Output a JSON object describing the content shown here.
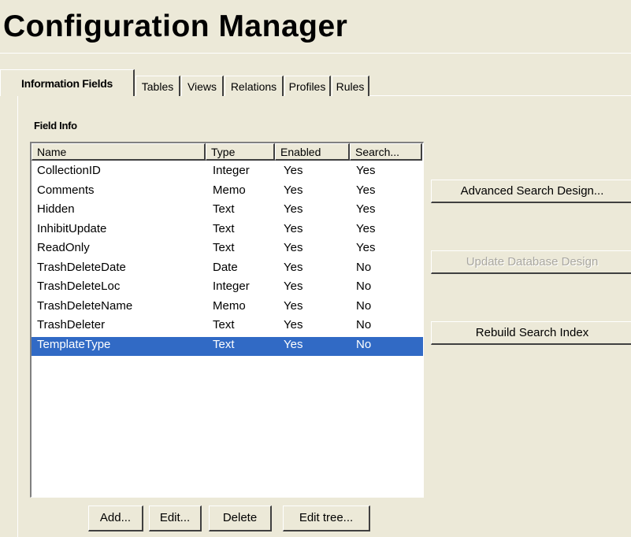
{
  "window": {
    "title": "Configuration Manager"
  },
  "tabs": [
    {
      "label": "Information Fields",
      "active": true
    },
    {
      "label": "Tables",
      "active": false
    },
    {
      "label": "Views",
      "active": false
    },
    {
      "label": "Relations",
      "active": false
    },
    {
      "label": "Profiles",
      "active": false
    },
    {
      "label": "Rules",
      "active": false
    }
  ],
  "field_info": {
    "label": "Field Info",
    "columns": [
      "Name",
      "Type",
      "Enabled",
      "Search..."
    ],
    "rows": [
      {
        "name": "CollectionID",
        "type": "Integer",
        "enabled": "Yes",
        "search": "Yes",
        "selected": false
      },
      {
        "name": "Comments",
        "type": "Memo",
        "enabled": "Yes",
        "search": "Yes",
        "selected": false
      },
      {
        "name": "Hidden",
        "type": "Text",
        "enabled": "Yes",
        "search": "Yes",
        "selected": false
      },
      {
        "name": "InhibitUpdate",
        "type": "Text",
        "enabled": "Yes",
        "search": "Yes",
        "selected": false
      },
      {
        "name": "ReadOnly",
        "type": "Text",
        "enabled": "Yes",
        "search": "Yes",
        "selected": false
      },
      {
        "name": "TrashDeleteDate",
        "type": "Date",
        "enabled": "Yes",
        "search": "No",
        "selected": false
      },
      {
        "name": "TrashDeleteLoc",
        "type": "Integer",
        "enabled": "Yes",
        "search": "No",
        "selected": false
      },
      {
        "name": "TrashDeleteName",
        "type": "Memo",
        "enabled": "Yes",
        "search": "No",
        "selected": false
      },
      {
        "name": "TrashDeleter",
        "type": "Text",
        "enabled": "Yes",
        "search": "No",
        "selected": false
      },
      {
        "name": "TemplateType",
        "type": "Text",
        "enabled": "Yes",
        "search": "No",
        "selected": true
      }
    ]
  },
  "side_buttons": {
    "advanced_search": {
      "label": "Advanced Search Design...",
      "enabled": true
    },
    "update_database": {
      "label": "Update Database Design",
      "enabled": false
    },
    "rebuild_index": {
      "label": "Rebuild Search Index",
      "enabled": true
    }
  },
  "bottom_buttons": {
    "add": "Add...",
    "edit": "Edit...",
    "delete": "Delete",
    "edit_tree": "Edit tree..."
  },
  "colors": {
    "window_bg": "#ECE9D8",
    "selection": "#316AC5",
    "disabled_text": "#A9A7A0"
  }
}
